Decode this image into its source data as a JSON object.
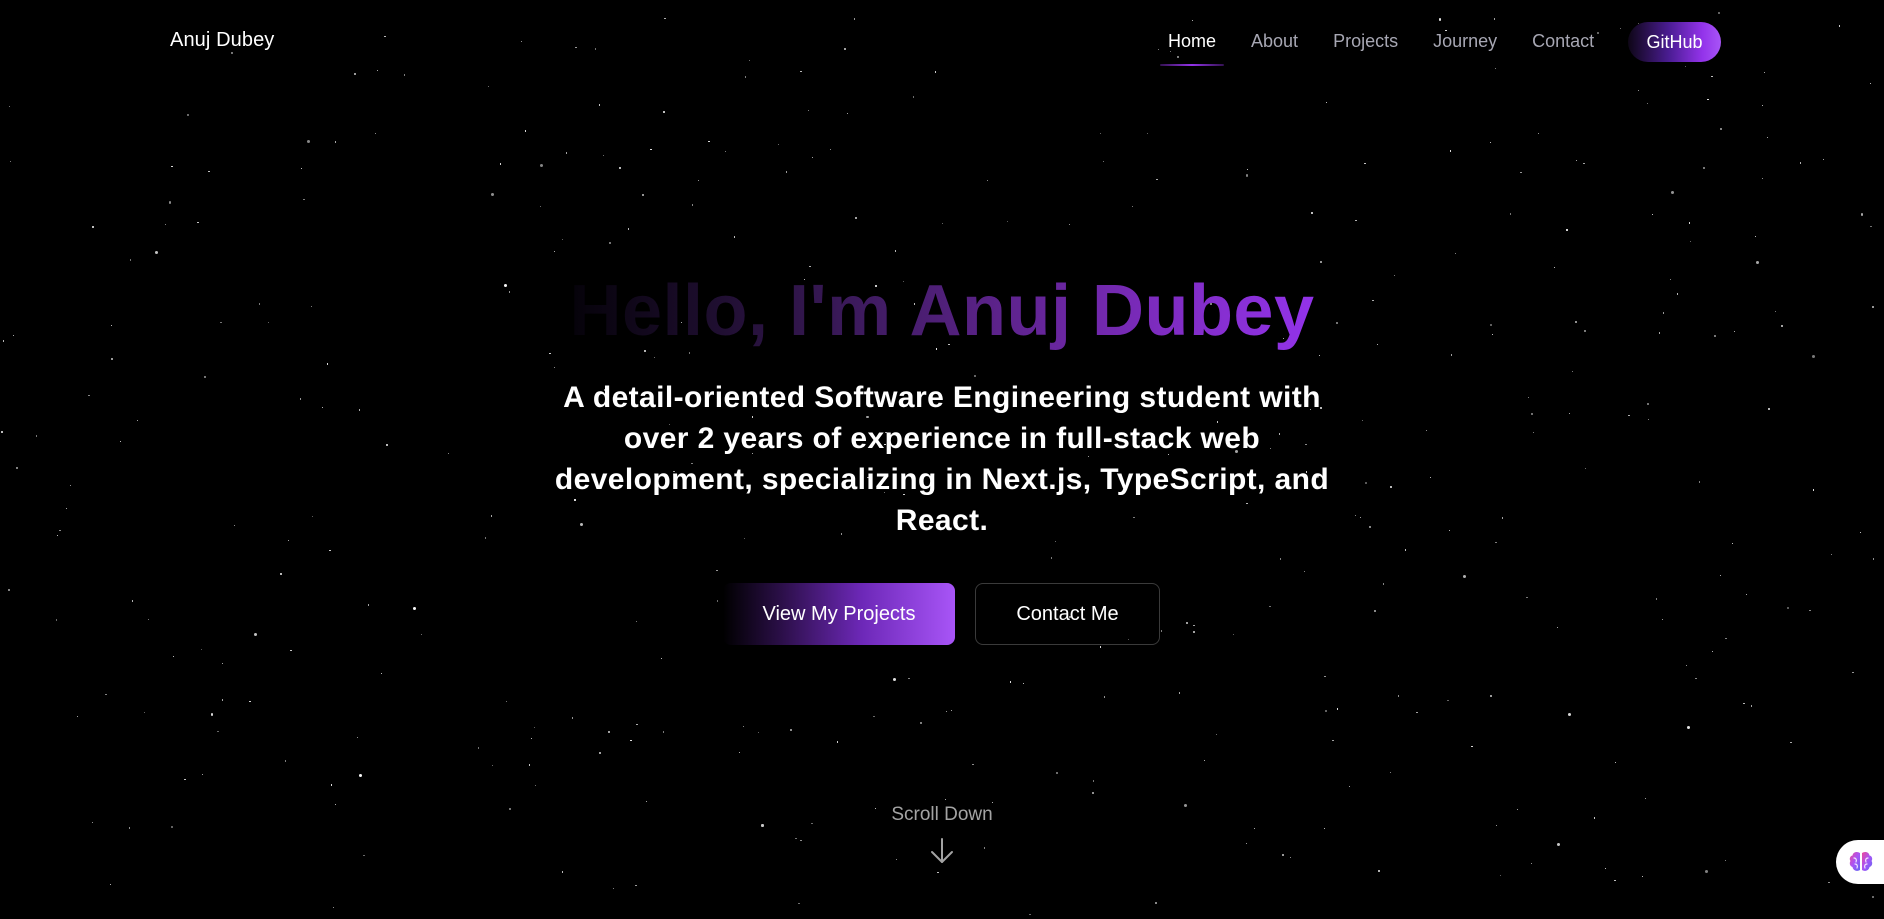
{
  "nav": {
    "brand": "Anuj Dubey",
    "links": [
      {
        "label": "Home",
        "active": true
      },
      {
        "label": "About",
        "active": false
      },
      {
        "label": "Projects",
        "active": false
      },
      {
        "label": "Journey",
        "active": false
      },
      {
        "label": "Contact",
        "active": false
      }
    ],
    "github_label": "GitHub"
  },
  "hero": {
    "title": "Hello, I'm Anuj Dubey",
    "subtitle": "A detail-oriented Software Engineering student with over 2 years of experience in full-stack web development, specializing in Next.js, TypeScript, and React.",
    "primary_button": "View My Projects",
    "secondary_button": "Contact Me"
  },
  "scroll": {
    "label": "Scroll Down",
    "icon": "arrow-down-icon"
  },
  "widget": {
    "icon": "brain-icon"
  },
  "colors": {
    "background": "#000000",
    "accent": "#9333ea",
    "accent_light": "#a855f7",
    "nav_text": "#a7a7b3",
    "muted_text": "#a3a3a3"
  }
}
